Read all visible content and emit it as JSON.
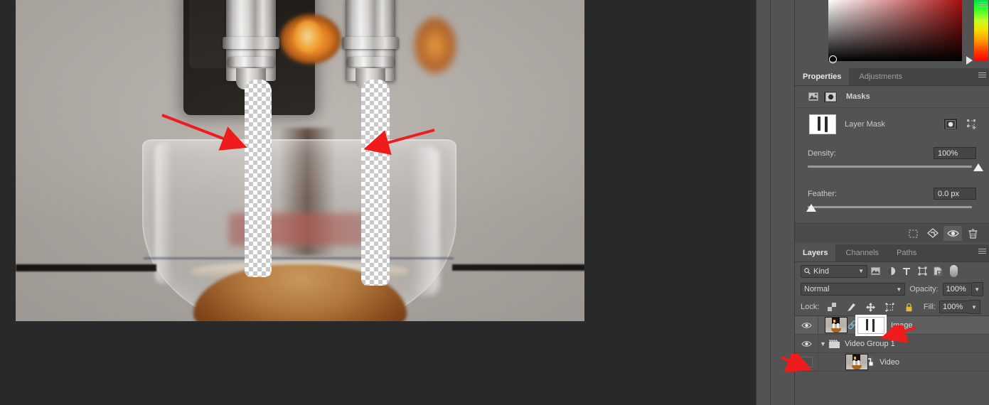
{
  "app": "Adobe Photoshop",
  "color_panel": {
    "name": "color-panel",
    "field_color": "#a60f0f",
    "hue_stops": [
      "#00e24a",
      "#c3ff22",
      "#f5e000",
      "#ff9b00",
      "#ff0000"
    ]
  },
  "properties_panel": {
    "tabs": [
      {
        "label": "Properties",
        "active": true
      },
      {
        "label": "Adjustments",
        "active": false
      }
    ],
    "section_label": "Masks",
    "pixel_mask_icon": "image-mask-icon",
    "vector_mask_icon": "vector-mask-icon",
    "mask_row": {
      "label": "Layer Mask",
      "thumb": "layer-mask-thumbnail",
      "buttons": [
        "select-mask-icon",
        "mask-options-icon"
      ]
    },
    "density": {
      "label": "Density:",
      "value": "100%",
      "knob_pct": 100
    },
    "feather": {
      "label": "Feather:",
      "value": "0.0 px",
      "knob_pct": 0
    },
    "footer_buttons": [
      {
        "name": "load-selection-icon",
        "active": false
      },
      {
        "name": "apply-mask-icon",
        "active": false
      },
      {
        "name": "toggle-mask-visibility-icon",
        "active": true
      },
      {
        "name": "delete-mask-icon",
        "active": false
      }
    ]
  },
  "layers_panel": {
    "tabs": [
      {
        "label": "Layers",
        "active": true
      },
      {
        "label": "Channels",
        "active": false
      },
      {
        "label": "Paths",
        "active": false
      }
    ],
    "filter": {
      "kind_label": "Kind",
      "search_icon": "search-icon",
      "icons": [
        "filter-pixel-icon",
        "filter-adjustment-icon",
        "filter-type-icon",
        "filter-shape-icon",
        "filter-smartobject-icon"
      ],
      "toggle": "filter-enable-toggle"
    },
    "blend": {
      "mode": "Normal",
      "opacity_label": "Opacity:",
      "opacity_value": "100%"
    },
    "lock": {
      "label": "Lock:",
      "icons": [
        "lock-transparency-icon",
        "lock-image-pixels-icon",
        "lock-position-icon",
        "lock-artboard-icon",
        "lock-all-icon"
      ],
      "fill_label": "Fill:",
      "fill_value": "100%"
    },
    "rows": [
      {
        "name": "Image",
        "visible": true,
        "selected": true,
        "has_link": true,
        "has_mask": true,
        "mask_selected": true,
        "type": "layer"
      },
      {
        "name": "Video Group 1",
        "visible": true,
        "selected": false,
        "expanded": true,
        "type": "group"
      },
      {
        "name": "Video",
        "visible": false,
        "selected": false,
        "type": "video",
        "indent": true
      }
    ]
  },
  "canvas": {
    "name": "document-canvas",
    "description": "Espresso machine pouring into glass cup, two vertical coffee streams erased to transparency",
    "transparency_label": "checkerboard-transparency"
  },
  "annotations": {
    "color": "#ee1c1c",
    "arrows": [
      {
        "name": "arrow-left-stream",
        "target": "left transparent stream"
      },
      {
        "name": "arrow-right-stream",
        "target": "right transparent stream"
      },
      {
        "name": "arrow-layer-mask-thumbnail",
        "target": "Image layer mask thumbnail"
      },
      {
        "name": "arrow-video-visibility",
        "target": "Video layer visibility cell"
      }
    ]
  }
}
